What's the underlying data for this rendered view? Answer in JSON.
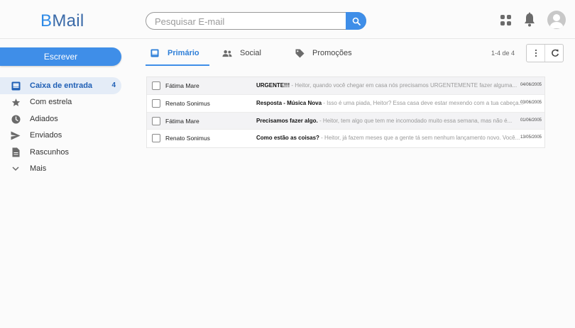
{
  "logo": {
    "b": "B",
    "rest": "Mail"
  },
  "search": {
    "placeholder": "Pesquisar E-mail"
  },
  "header_icons": [
    "apps-grid-icon",
    "bell-icon",
    "avatar-icon"
  ],
  "compose_label": "Escrever",
  "sidebar": {
    "items": [
      {
        "label": "Caixa de entrada",
        "count": "4",
        "icon": "inbox-icon"
      },
      {
        "label": "Com estrela",
        "count": "",
        "icon": "star-icon"
      },
      {
        "label": "Adiados",
        "count": "",
        "icon": "clock-icon"
      },
      {
        "label": "Enviados",
        "count": "",
        "icon": "send-icon"
      },
      {
        "label": "Rascunhos",
        "count": "",
        "icon": "draft-icon"
      },
      {
        "label": "Mais",
        "count": "",
        "icon": "chevron-down-icon"
      }
    ]
  },
  "tabs": [
    {
      "label": "Primário",
      "icon": "inbox-icon"
    },
    {
      "label": "Social",
      "icon": "people-icon"
    },
    {
      "label": "Promoções",
      "icon": "tag-icon"
    }
  ],
  "pagination": "1-4 de 4",
  "emails": [
    {
      "sender": "Fátima Mare",
      "subject": "URGENTE!!!",
      "snippet": "Heitor, quando você chegar em casa nós precisamos URGENTEMENTE fazer alguma...",
      "date": "04/06/2005"
    },
    {
      "sender": "Renato Sonimus",
      "subject": "Resposta - Música Nova",
      "snippet": "Isso é uma piada, Heitor? Essa casa deve estar mexendo com a tua cabeça...",
      "date": "03/06/2005"
    },
    {
      "sender": "Fátima Mare",
      "subject": "Precisamos fazer algo.",
      "snippet": "Heitor, tem algo que tem me incomodado muito essa semana, mas não é...",
      "date": "01/06/2005"
    },
    {
      "sender": "Renato Sonimus",
      "subject": "Como estão as coisas?",
      "snippet": "Heitor, já fazem meses que a gente tá sem nenhum lançamento novo. Você...",
      "date": "13/05/2005"
    }
  ],
  "colors": {
    "accent": "#3f8ee8",
    "active_bg": "#e4ecf7",
    "active_text": "#1f5fb5"
  }
}
